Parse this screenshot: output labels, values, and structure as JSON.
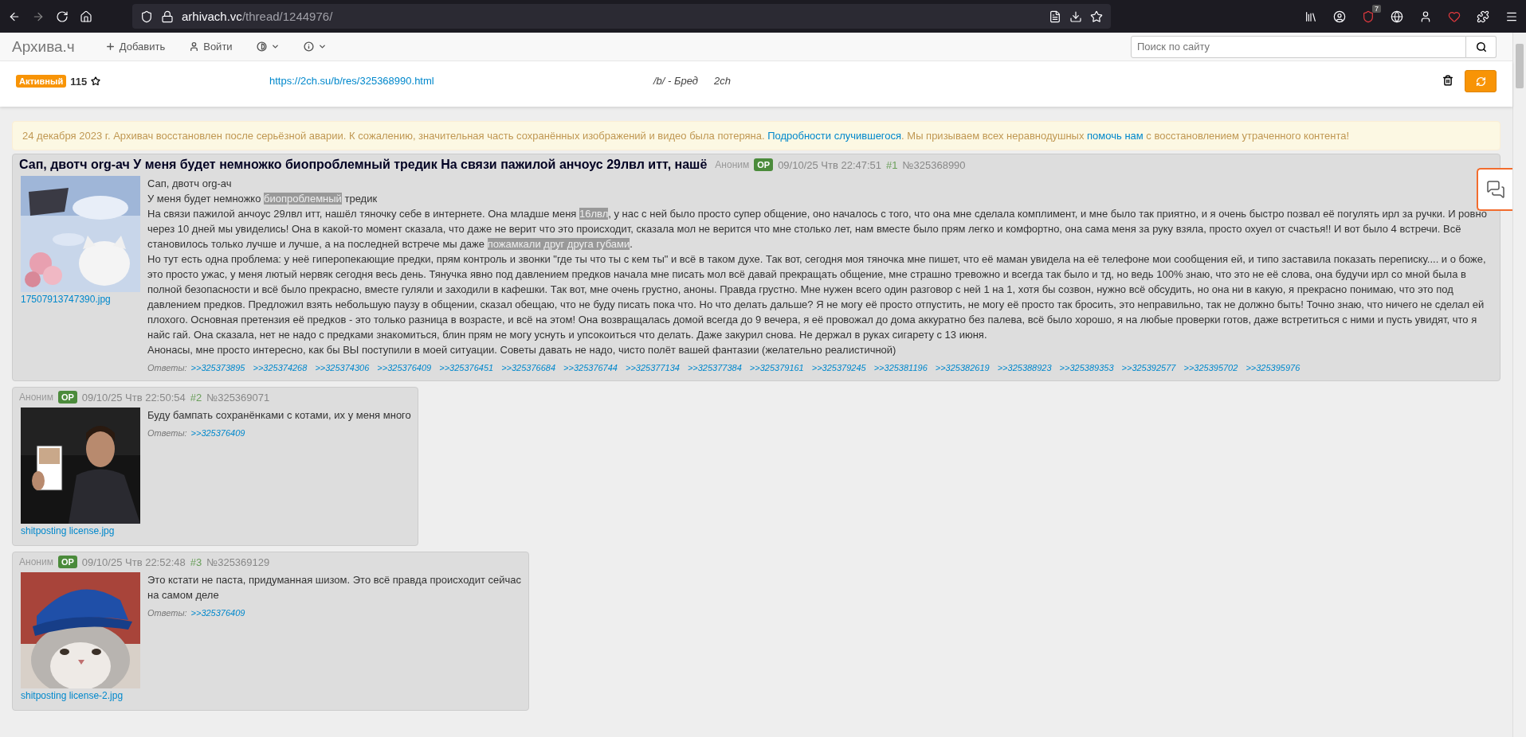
{
  "browser": {
    "url_host": "arhivach.vc",
    "url_path": "/thread/1244976/",
    "extension_badge": "7"
  },
  "navbar": {
    "brand": "Архива.ч",
    "items": [
      {
        "kind": "link",
        "label": "Добавить"
      },
      {
        "kind": "link",
        "label": "Войти"
      },
      {
        "kind": "dropdown"
      },
      {
        "kind": "dropdown"
      }
    ],
    "search": {
      "placeholder": "Поиск по сайту"
    }
  },
  "thread": {
    "status": "Активный",
    "count": "115",
    "source_link": "https://2ch.su/b/res/325368990.html",
    "board": "/b/ - Бред",
    "site": "2ch"
  },
  "notice": [
    {
      "text": "24 декабря 2023 г. Архивач восстановлен после серьёзной аварии. К сожалению, значительная часть сохранённых изображений и видео была потеряна. ",
      "link": false
    },
    {
      "text": "Подробности случившегося",
      "link": true
    },
    {
      "text": ". Мы призываем всех неравнодушных ",
      "link": false
    },
    {
      "text": "помочь нам",
      "link": true
    },
    {
      "text": " с восстановлением утраченного контента!",
      "link": false
    }
  ],
  "posts": [
    {
      "title": "Сап, двотч org-ач У меня будет немножко биопроблемный тредик На связи пажилой анчоус 29лвл итт, нашё",
      "author": "Аноним",
      "badge": "OP",
      "date": "09/10/25 Чтв 22:47:51",
      "number": "#1",
      "id": "№325368990",
      "image": {
        "kind": "picture",
        "file": "17507913747390.jpg"
      },
      "paragraphs": [
        [
          {
            "text": "Сап, двотч org-ач",
            "spoiler": false
          }
        ],
        [
          {
            "text": "У меня будет немножко ",
            "spoiler": false
          },
          {
            "text": "биопроблемный",
            "spoiler": true
          },
          {
            "text": " тредик",
            "spoiler": false
          }
        ],
        [
          {
            "text": "На связи пажилой анчоус 29лвл итт, нашёл тяночку себе в интернете. Она младше меня ",
            "spoiler": false
          },
          {
            "text": "16лвл",
            "spoiler": true
          },
          {
            "text": ", у нас с ней было просто супер общение, оно началось с того, что она мне сделала комплимент, и мне было так приятно, и я очень быстро позвал её погулять ирл за ручки. И ровно через 10 дней мы увиделись! Она в какой-то момент сказала, что даже не верит что это происходит, сказала мол не верится что мне столько лет, нам вместе было прям легко и комфортно, она сама меня за руку взяла, просто охуел от счастья!! И вот было 4 встречи. Всё становилось только лучше и лучше, а на последней встрече мы даже ",
            "spoiler": false
          },
          {
            "text": "пожамкали друг друга губами",
            "spoiler": true
          },
          {
            "text": ".",
            "spoiler": false
          }
        ],
        [
          {
            "text": "Но тут есть одна проблема: у неё гиперопекающие предки, прям контроль и звонки \"где ты что ты с кем ты\" и всё в таком духе. Так вот, сегодня моя тяночка мне пишет, что её маман увидела на её телефоне мои сообщения ей, и типо заставила показать переписку.... и о боже, это просто ужас, у меня лютый нервяк сегодня весь день. Тянучка явно под давлением предков начала мне писать мол всё давай прекращать общение, мне страшно тревожно и всегда так было и тд, но ведь 100% знаю, что это не её слова, она будучи ирл со мной была в полной безопасности и всё было прекрасно, вместе гуляли и заходили в кафешки. Так вот, мне очень грустно, аноны. Правда грустно. Мне нужен всего один разговор с ней 1 на 1, хотя бы созвон, нужно всё обсудить, но она ни в какую, я прекрасно понимаю, что это под давлением предков. Предложил взять небольшую паузу в общении, сказал обещаю, что не буду писать пока что. Но что делать дальше? Я не могу её просто отпустить, не могу её просто так бросить, это неправильно, так не должно быть! Точно знаю, что ничего не сделал ей плохого. Основная претензия её предков - это только разница в возрасте, и всё на этом! Она возвращалась домой всегда до 9 вечера, я её провожал до дома аккуратно без палева, всё было хорошо, я на любые проверки готов, даже встретиться с ними и пусть увидят, что я найс гай. Она сказала, нет не надо с предками знакомиться, блин прям не могу уснуть и упсокоиться что делать. Даже закурил снова. Не держал в руках сигарету с 13 июня.",
            "spoiler": false
          }
        ],
        [
          {
            "text": "Анонасы, мне просто интересно, как бы ВЫ поступили в моей ситуации. Советы давать не надо, чисто полёт вашей фантазии (желательно реалистичной)",
            "spoiler": false
          }
        ]
      ],
      "replies_label": "Ответы:",
      "replies": [
        ">>325373895",
        ">>325374268",
        ">>325374306",
        ">>325376409",
        ">>325376451",
        ">>325376684",
        ">>325376744",
        ">>325377134",
        ">>325377384",
        ">>325379161",
        ">>325379245",
        ">>325381196",
        ">>325382619",
        ">>325388923",
        ">>325389353",
        ">>325392577",
        ">>325395702",
        ">>325395976"
      ]
    },
    {
      "author": "Аноним",
      "badge": "OP",
      "date": "09/10/25 Чтв 22:50:54",
      "number": "#2",
      "id": "№325369071",
      "image": {
        "kind": "picture",
        "file": "shitposting license.jpg"
      },
      "paragraphs": [
        [
          {
            "text": "Буду бампать сохранёнками с котами, их у меня много",
            "spoiler": false
          }
        ]
      ],
      "replies_label": "Ответы:",
      "replies": [
        ">>325376409"
      ]
    },
    {
      "author": "Аноним",
      "badge": "OP",
      "date": "09/10/25 Чтв 22:52:48",
      "number": "#3",
      "id": "№325369129",
      "image": {
        "kind": "picture",
        "file": "shitposting license-2.jpg"
      },
      "paragraphs": [
        [
          {
            "text": "Это кстати не паста, придуманная шизом. Это всё правда происходит сейчас на самом деле",
            "spoiler": false
          }
        ]
      ],
      "replies_label": "Ответы:",
      "replies": [
        ">>325376409"
      ]
    }
  ]
}
